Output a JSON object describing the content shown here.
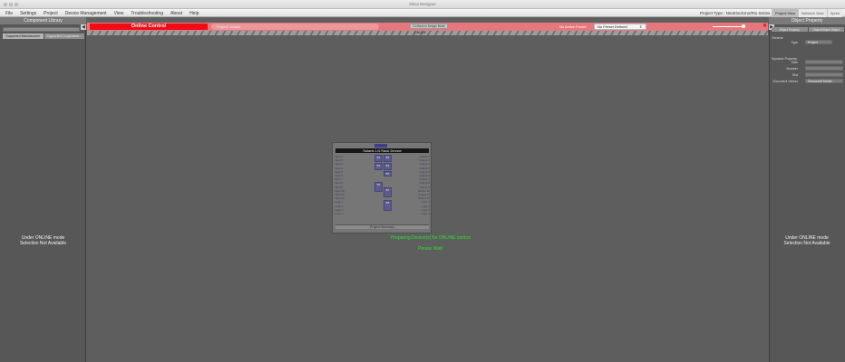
{
  "window": {
    "title": "Xilica Designer"
  },
  "menu": {
    "items": [
      "File",
      "Settings",
      "Project",
      "Device Management",
      "View",
      "Troubleshooting",
      "About",
      "Help"
    ],
    "project_type": "Project Type : Neutrino/Uno/Rio Series",
    "right_tabs": [
      "Project View",
      "Network View",
      "Xpres"
    ]
  },
  "left_panel": {
    "title": "Component Library",
    "tabs": [
      "Supported Manufacturer",
      "Supported Cooperative..."
    ],
    "message_line1": "Under ONLINE mode",
    "message_line2": "Selection Not Available"
  },
  "toolbar": {
    "online_label": "Online Control",
    "project_label": "Project: solaris",
    "design_mode_label": "Go Back to Design Mode",
    "hatch_label": "ONLINE",
    "active_preset_label": "No Active Preset",
    "preset_value": "No Preset Defined"
  },
  "right_panel": {
    "title": "Object Property",
    "tabs": [
      "Object Property",
      "Object/Object Object"
    ],
    "general_label": "General",
    "dynamic_label": "Dynamic Property",
    "rows": [
      {
        "label": "Type",
        "value": "Project"
      },
      {
        "label": "Gain",
        "value": ""
      },
      {
        "label": "Number",
        "value": ""
      },
      {
        "label": "Slot",
        "value": ""
      },
      {
        "label": "Document Viewer",
        "value": "Document Model"
      }
    ],
    "message_line1": "Under ONLINE mode",
    "message_line2": "Selection Not Available"
  },
  "device": {
    "title": "Solaris 1/4 Rack Device",
    "footer": "Project Summary",
    "inputs": [
      "Input 1",
      "Input 2",
      "Input 3",
      "Input 4",
      "Input 5",
      "Input 6",
      "Input 7",
      "Input 8",
      "Input 9",
      "Input 10",
      "Input 11",
      "Input 12",
      "Logic 1",
      "Logic 2",
      "Logic 3",
      "Logic 4"
    ],
    "outputs": [
      "Output 1",
      "Output 2",
      "Output 3",
      "Output 4",
      "Output 5",
      "Output 6",
      "Output 7",
      "Output 8",
      "Output 9",
      "Output 10",
      "Output 11",
      "Output 12",
      "Logic 1",
      "Logic 2",
      "Logic 3",
      "Logic 4"
    ],
    "blocks": [
      "B1",
      "B2",
      "B3",
      "B4",
      "B5",
      "B6",
      "B7",
      "B8"
    ]
  },
  "status": {
    "line1": "Preparing Device(s) for ONLINE control",
    "line2": "Please Wait!"
  },
  "colors": {
    "online_red": "#f00c17",
    "toolbar_pink": "#e6787d",
    "status_green": "#27e32d",
    "dsp_block": "#5b5b91"
  }
}
